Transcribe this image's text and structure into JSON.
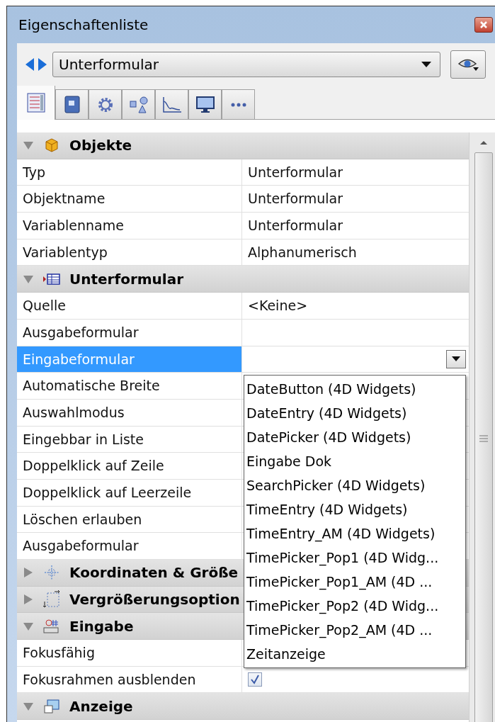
{
  "window": {
    "title": "Eigenschaftenliste"
  },
  "toolbar": {
    "object_select": {
      "value": "Unterformular"
    }
  },
  "tabs": [
    {
      "selected": true
    },
    {
      "selected": false
    },
    {
      "selected": false
    },
    {
      "selected": false
    },
    {
      "selected": false
    },
    {
      "selected": false
    },
    {
      "selected": false
    }
  ],
  "sections": [
    {
      "title": "Objekte",
      "expanded": true,
      "rows": [
        {
          "label": "Typ",
          "value": "Unterformular",
          "selected": false,
          "kind": "text"
        },
        {
          "label": "Objektname",
          "value": "Unterformular",
          "selected": false,
          "kind": "text"
        },
        {
          "label": "Variablenname",
          "value": "Unterformular",
          "selected": false,
          "kind": "text"
        },
        {
          "label": "Variablentyp",
          "value": "Alphanumerisch",
          "selected": false,
          "kind": "text"
        }
      ]
    },
    {
      "title": "Unterformular",
      "expanded": true,
      "rows": [
        {
          "label": "Quelle",
          "value": "<Keine>",
          "selected": false,
          "kind": "text"
        },
        {
          "label": "Ausgabeformular",
          "selected": false,
          "kind": "text"
        },
        {
          "label": "Eingabeformular",
          "selected": true,
          "kind": "dropdown",
          "open": true,
          "options": [
            "DateButton (4D Widgets)",
            "DateEntry (4D Widgets)",
            "DatePicker (4D Widgets)",
            "Eingabe Dok",
            "SearchPicker (4D Widgets)",
            "TimeEntry (4D Widgets)",
            "TimeEntry_AM (4D Widgets)",
            "TimePicker_Pop1 (4D Widg...",
            "TimePicker_Pop1_AM (4D ...",
            "TimePicker_Pop2 (4D Widg...",
            "TimePicker_Pop2_AM (4D ...",
            "Zeitanzeige"
          ]
        },
        {
          "label": "Automatische Breite",
          "selected": false,
          "kind": "text"
        },
        {
          "label": "Auswahlmodus",
          "selected": false,
          "kind": "text"
        },
        {
          "label": "Eingebbar in Liste",
          "selected": false,
          "kind": "text"
        },
        {
          "label": "Doppelklick auf Zeile",
          "selected": false,
          "kind": "text"
        },
        {
          "label": "Doppelklick auf Leerzeile",
          "selected": false,
          "kind": "text"
        },
        {
          "label": "Löschen erlauben",
          "selected": false,
          "kind": "text"
        },
        {
          "label": "Ausgabeformular",
          "selected": false,
          "kind": "text"
        }
      ]
    },
    {
      "title": "Koordinaten & Größe",
      "expanded": false
    },
    {
      "title": "Vergrößerungsoption",
      "expanded": false
    },
    {
      "title": "Eingabe",
      "expanded": true,
      "rows": [
        {
          "label": "Fokusfähig",
          "selected": false,
          "kind": "text"
        },
        {
          "label": "Fokusrahmen ausblenden",
          "selected": false,
          "kind": "checkbox",
          "checked": true
        }
      ]
    },
    {
      "title": "Anzeige",
      "expanded": true
    }
  ]
}
